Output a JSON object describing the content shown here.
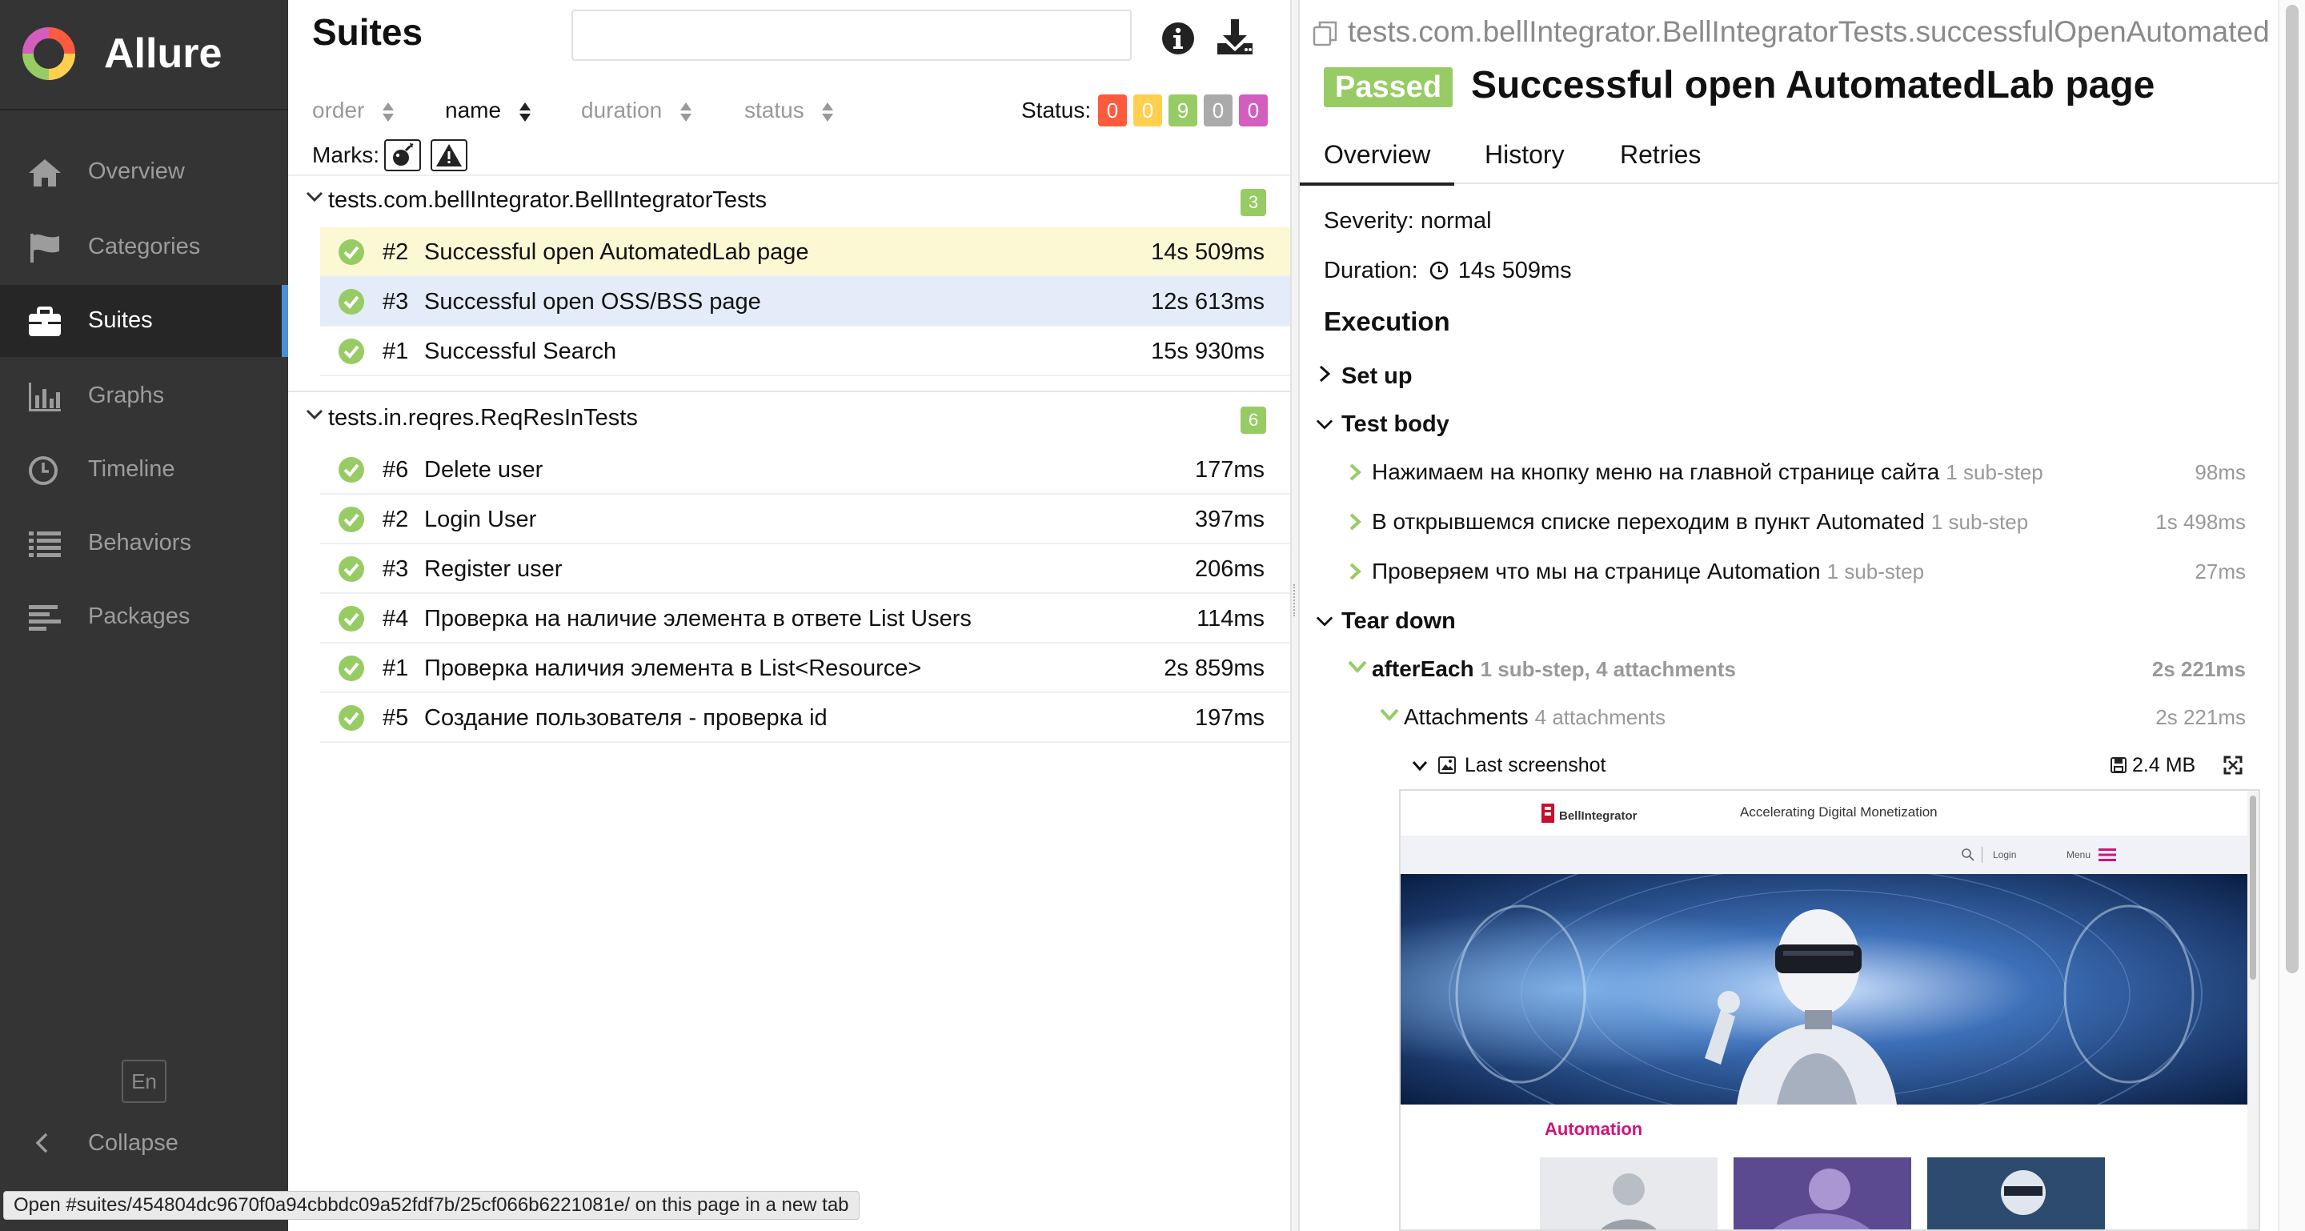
{
  "app": {
    "name": "Allure"
  },
  "sidebar": {
    "items": [
      {
        "label": "Overview",
        "icon": "home-icon"
      },
      {
        "label": "Categories",
        "icon": "flag-icon"
      },
      {
        "label": "Suites",
        "icon": "briefcase-icon",
        "active": true
      },
      {
        "label": "Graphs",
        "icon": "bar-chart-icon"
      },
      {
        "label": "Timeline",
        "icon": "clock-icon"
      },
      {
        "label": "Behaviors",
        "icon": "list-icon"
      },
      {
        "label": "Packages",
        "icon": "align-left-icon"
      }
    ],
    "language": "En",
    "collapse_label": "Collapse"
  },
  "suites": {
    "title": "Suites",
    "search": {
      "placeholder": "",
      "value": ""
    },
    "sort": {
      "order": "order",
      "name": "name",
      "duration": "duration",
      "status": "status"
    },
    "status_label": "Status:",
    "status_counts": [
      {
        "value": "0",
        "color": "#fd5a3e"
      },
      {
        "value": "0",
        "color": "#ffd050"
      },
      {
        "value": "9",
        "color": "#97cc64"
      },
      {
        "value": "0",
        "color": "#aaaaaa"
      },
      {
        "value": "0",
        "color": "#d35ebe"
      }
    ],
    "marks_label": "Marks:",
    "groups": [
      {
        "name": "tests.com.bellIntegrator.BellIntegratorTests",
        "count": "3",
        "tests": [
          {
            "num": "#2",
            "name": "Successful open AutomatedLab page",
            "duration": "14s 509ms",
            "state": "selected"
          },
          {
            "num": "#3",
            "name": "Successful open OSS/BSS page",
            "duration": "12s 613ms",
            "state": "hover"
          },
          {
            "num": "#1",
            "name": "Successful Search",
            "duration": "15s 930ms",
            "state": ""
          }
        ]
      },
      {
        "name": "tests.in.reqres.ReqResInTests",
        "count": "6",
        "tests": [
          {
            "num": "#6",
            "name": "Delete user",
            "duration": "177ms"
          },
          {
            "num": "#2",
            "name": "Login User",
            "duration": "397ms"
          },
          {
            "num": "#3",
            "name": "Register user",
            "duration": "206ms"
          },
          {
            "num": "#4",
            "name": "Проверка на наличие элемента в ответе List Users",
            "duration": "114ms"
          },
          {
            "num": "#1",
            "name": "Проверка наличия элемента в List<Resource>",
            "duration": "2s 859ms"
          },
          {
            "num": "#5",
            "name": "Создание пользователя - проверка id",
            "duration": "197ms"
          }
        ]
      }
    ]
  },
  "detail": {
    "full_name": "tests.com.bellIntegrator.BellIntegratorTests.successfulOpenAutomated…",
    "status": "Passed",
    "status_color": "#97cc64",
    "title": "Successful open AutomatedLab page",
    "tabs": [
      "Overview",
      "History",
      "Retries"
    ],
    "severity": "Severity: normal",
    "duration_label": "Duration:",
    "duration": "14s 509ms",
    "execution_title": "Execution",
    "setup_label": "Set up",
    "body_label": "Test body",
    "steps": [
      {
        "text": "Нажимаем на кнопку меню на главной странице сайта",
        "sub": "1 sub-step",
        "duration": "98ms"
      },
      {
        "text": "В открывшемся списке переходим в пункт Automated",
        "sub": "1 sub-step",
        "duration": "1s 498ms"
      },
      {
        "text": "Проверяем что мы на странице Automation",
        "sub": "1 sub-step",
        "duration": "27ms"
      }
    ],
    "teardown_label": "Tear down",
    "after_each": {
      "text": "afterEach",
      "sub": "1 sub-step, 4 attachments",
      "duration": "2s 221ms"
    },
    "attachments": {
      "text": "Attachments",
      "sub": "4 attachments",
      "duration": "2s 221ms"
    },
    "screenshot": {
      "name": "Last screenshot",
      "size": "2.4 MB",
      "site": {
        "brand": "BellIntegrator",
        "slogan": "Accelerating Digital Monetization",
        "login": "Login",
        "menu": "Menu",
        "section_title": "Automation",
        "accent": "#d4117a"
      }
    }
  },
  "status_bar": {
    "url_text": "Open #suites/454804dc9670f0a94cbbdc09a52fdf7b/25cf066b6221081e/ on this page in a new tab"
  }
}
